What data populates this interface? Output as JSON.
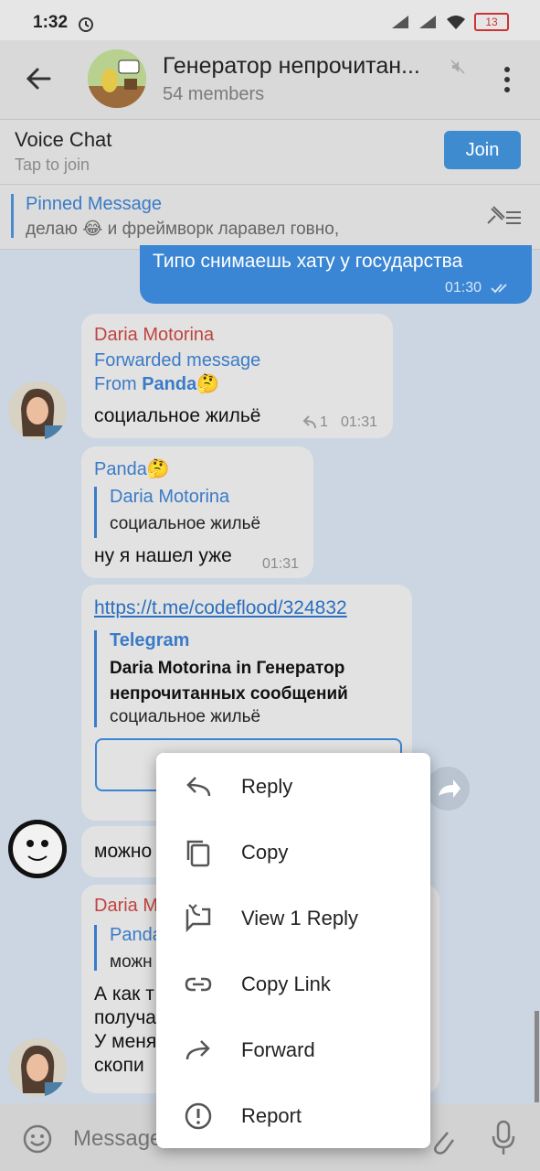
{
  "status": {
    "time": "1:32",
    "battery": "13"
  },
  "header": {
    "title": "Генератор непрочитан...",
    "members": "54 members"
  },
  "voice_chat": {
    "title": "Voice Chat",
    "subtitle": "Tap to join",
    "join_label": "Join"
  },
  "pinned": {
    "title": "Pinned Message",
    "text": "делаю 😂 и фреймворк ларавел говно,"
  },
  "messages": {
    "m1": {
      "text": "Типо снимаешь хату у государства",
      "time": "01:30"
    },
    "m2": {
      "sender": "Daria Motorina",
      "forwarded": "Forwarded message",
      "from_prefix": "From ",
      "from_name": "Panda🤔",
      "text": "социальное жильё",
      "replies": "1",
      "time": "01:31"
    },
    "m3": {
      "sender": "Panda🤔",
      "quote_name": "Daria Motorina",
      "quote_text": "социальное жильё",
      "text": "ну я нашел уже",
      "time": "01:31"
    },
    "m4": {
      "link": "https://t.me/codeflood/324832",
      "preview_site": "Telegram",
      "preview_title": "Daria Motorina in Генератор непрочитанных сообщений",
      "preview_text": "социальное жильё"
    },
    "m5": {
      "text": "можно"
    },
    "m6": {
      "sender": "Daria M",
      "quote_name": "Panda",
      "quote_text": "можн",
      "line1": "А как т",
      "line2": "получа",
      "line3": "У меня",
      "line4": "скопи"
    }
  },
  "context_menu": {
    "items": [
      {
        "label": "Reply",
        "icon": "reply-icon"
      },
      {
        "label": "Copy",
        "icon": "copy-icon"
      },
      {
        "label": "View 1 Reply",
        "icon": "view-replies-icon"
      },
      {
        "label": "Copy Link",
        "icon": "link-icon"
      },
      {
        "label": "Forward",
        "icon": "forward-icon"
      },
      {
        "label": "Report",
        "icon": "report-icon"
      }
    ]
  },
  "input": {
    "placeholder": "Message"
  },
  "colors": {
    "accent": "#3a86d4",
    "sender_red": "#c0443f",
    "link_blue": "#3a7bc8"
  }
}
